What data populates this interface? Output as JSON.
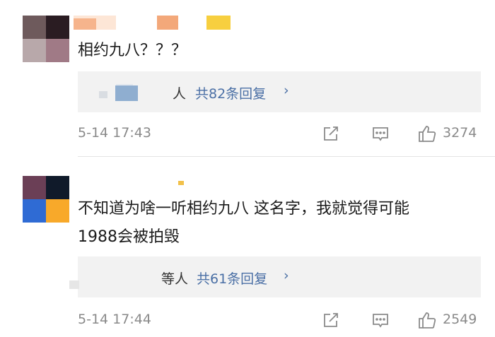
{
  "comments": [
    {
      "text": "相约九八？？？",
      "replies": {
        "who_suffix": "人",
        "more_label": "共82条回复",
        "chevron": "›"
      },
      "time": "5-14 17:43",
      "likes": "3274"
    },
    {
      "text": "不知道为啥一听相约九八 这名字，我就觉得可能\n1988会被拍毁",
      "replies": {
        "who_suffix": "等人",
        "more_label": "共61条回复",
        "chevron": "›"
      },
      "time": "5-14 17:44",
      "likes": "2549"
    }
  ],
  "colors": {
    "reply_link": "#4a6fa5",
    "meta_gray": "#8a8a8a",
    "reply_bg": "#f2f2f2"
  },
  "icons": [
    "edit-share-icon",
    "comment-icon",
    "like-icon"
  ]
}
